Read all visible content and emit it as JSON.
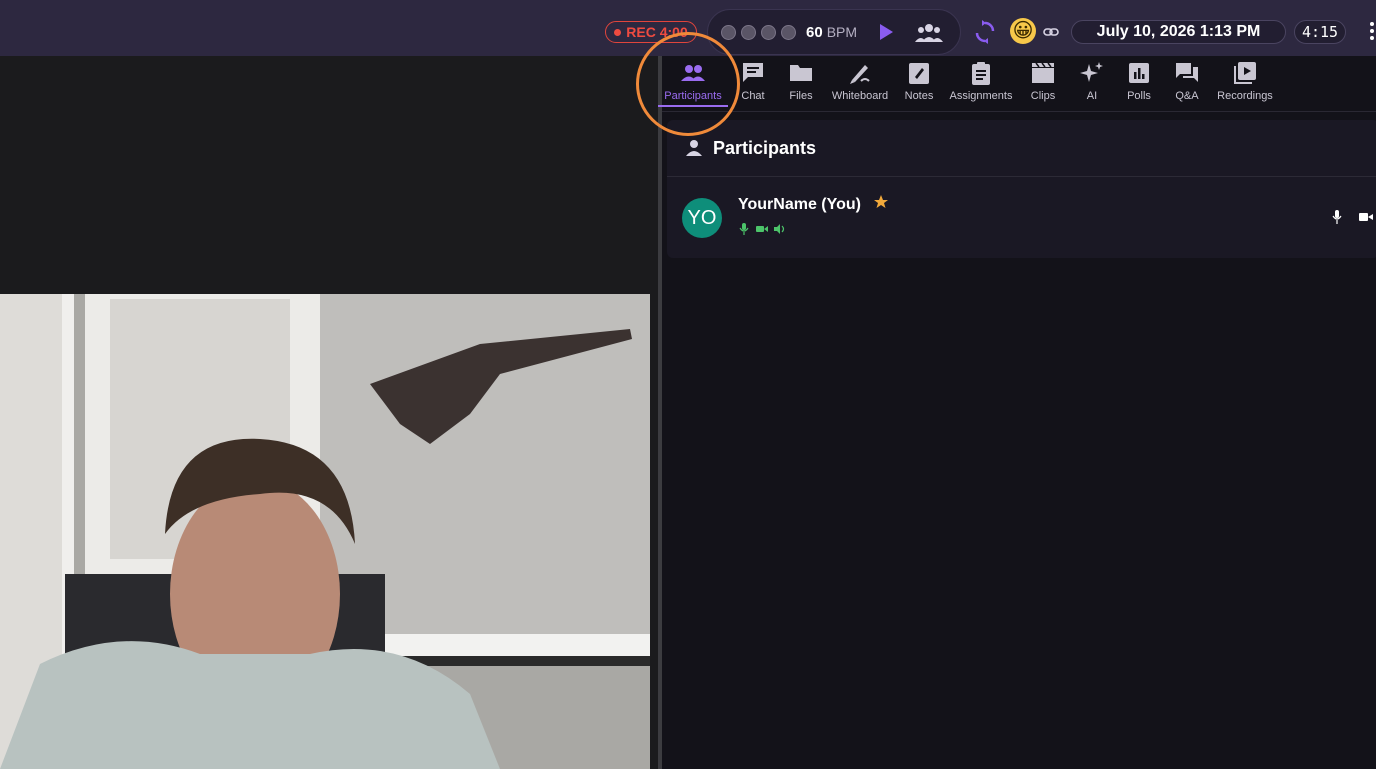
{
  "topbar": {
    "rec_label": "REC 4:00",
    "bpm_value": "60",
    "bpm_unit": "BPM",
    "emoji": "😀",
    "datetime": "July 10, 2026 1:13 PM",
    "timer": "4:15",
    "icons": [
      "record-dot-icon",
      "play-icon",
      "group-icon",
      "sync-icon",
      "emoji-icon",
      "link-icon",
      "kebab-menu-icon"
    ]
  },
  "tabs": [
    {
      "label": "Participants",
      "icon": "participants-icon",
      "active": true
    },
    {
      "label": "Chat",
      "icon": "chat-icon"
    },
    {
      "label": "Files",
      "icon": "folder-icon"
    },
    {
      "label": "Whiteboard",
      "icon": "whiteboard-icon"
    },
    {
      "label": "Notes",
      "icon": "notes-icon"
    },
    {
      "label": "Assignments",
      "icon": "assignments-icon"
    },
    {
      "label": "Clips",
      "icon": "clips-icon"
    },
    {
      "label": "AI",
      "icon": "sparkle-icon"
    },
    {
      "label": "Polls",
      "icon": "polls-icon"
    },
    {
      "label": "Q&A",
      "icon": "qa-icon"
    },
    {
      "label": "Recordings",
      "icon": "recordings-icon"
    }
  ],
  "panel": {
    "title": "Participants",
    "participants": [
      {
        "initials": "YO",
        "name": "YourName (You)",
        "host": true
      }
    ]
  },
  "colors": {
    "accent": "#9a6cf0",
    "rec": "#ef4b40",
    "highlight": "#f08a3a",
    "avatar": "#0e8e7a",
    "status_green": "#4cc46a",
    "star": "#f2a93b"
  }
}
